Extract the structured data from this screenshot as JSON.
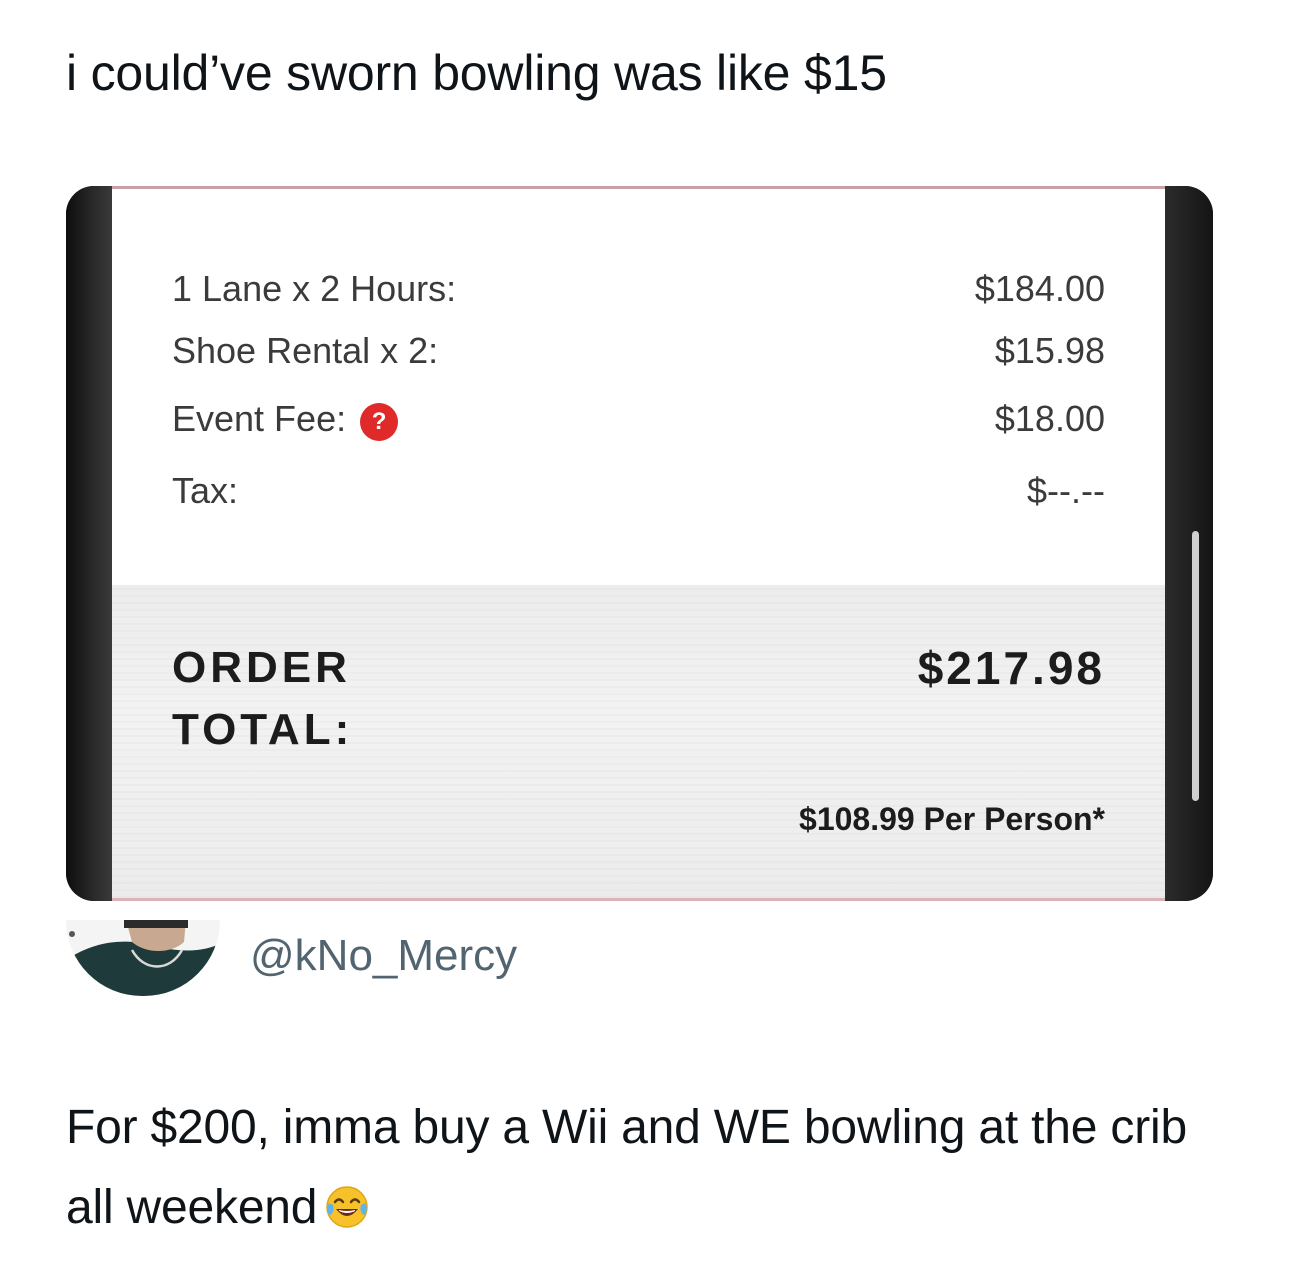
{
  "post": {
    "text": "i could’ve sworn bowling was like $15"
  },
  "receipt": {
    "items": [
      {
        "label": "1 Lane x 2 Hours:",
        "amount": "$184.00"
      },
      {
        "label": "Shoe Rental x 2:",
        "amount": "$15.98"
      },
      {
        "label": "Event Fee:",
        "amount": "$18.00",
        "help": "?"
      },
      {
        "label": "Tax:",
        "amount": "$--.--"
      }
    ],
    "order_total_label": "ORDER TOTAL:",
    "order_total_amount": "$217.98",
    "per_person": "$108.99 Per Person*"
  },
  "reply": {
    "handle": "@kNo_Mercy",
    "text": "For $200, imma buy a Wii and WE bowling at the crib all weekend",
    "emoji": "face-with-tears-of-joy"
  },
  "colors": {
    "help_icon": "#e02a2a",
    "handle": "#536471",
    "receipt_divider": "#c8a0a6"
  }
}
